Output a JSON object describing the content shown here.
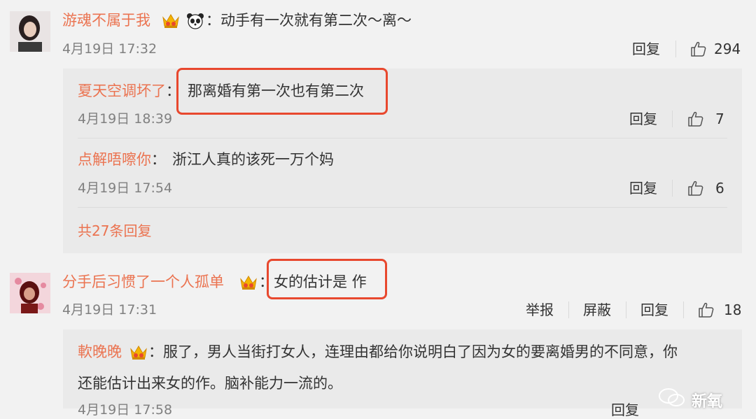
{
  "comments": [
    {
      "user": "游魂不属于我",
      "text": "动手有一次就有第二次～离～",
      "time": "4月19日 17:32",
      "reply_label": "回复",
      "likes": "294",
      "replies": [
        {
          "user": "夏天空调坏了",
          "text": "那离婚有第一次也有第二次",
          "time": "4月19日 18:39",
          "reply_label": "回复",
          "likes": "7"
        },
        {
          "user": "点解唔嚓你",
          "text": "浙江人真的该死一万个妈",
          "time": "4月19日 17:54",
          "reply_label": "回复",
          "likes": "6"
        }
      ],
      "more_replies": "共27条回复"
    },
    {
      "user": "分手后习惯了一个人孤单",
      "text": "女的估计是 作",
      "time": "4月19日 17:31",
      "report_label": "举报",
      "block_label": "屏蔽",
      "reply_label": "回复",
      "likes": "18",
      "replies": [
        {
          "user": "軟晚晚",
          "text_line1": "服了，男人当街打女人，连理由都给你说明白了因为女的要离婚男的不同意，你",
          "text_line2": "还能估计出来女的作。脑补能力一流的。",
          "time": "4月19日 17:58",
          "reply_label": "回复"
        }
      ]
    }
  ],
  "colon": "：",
  "watermark": "新氧",
  "colors": {
    "username": "#eb7350",
    "highlight": "#e8482e",
    "background": "#f2f2f2",
    "reply_box": "#eaeaea"
  }
}
